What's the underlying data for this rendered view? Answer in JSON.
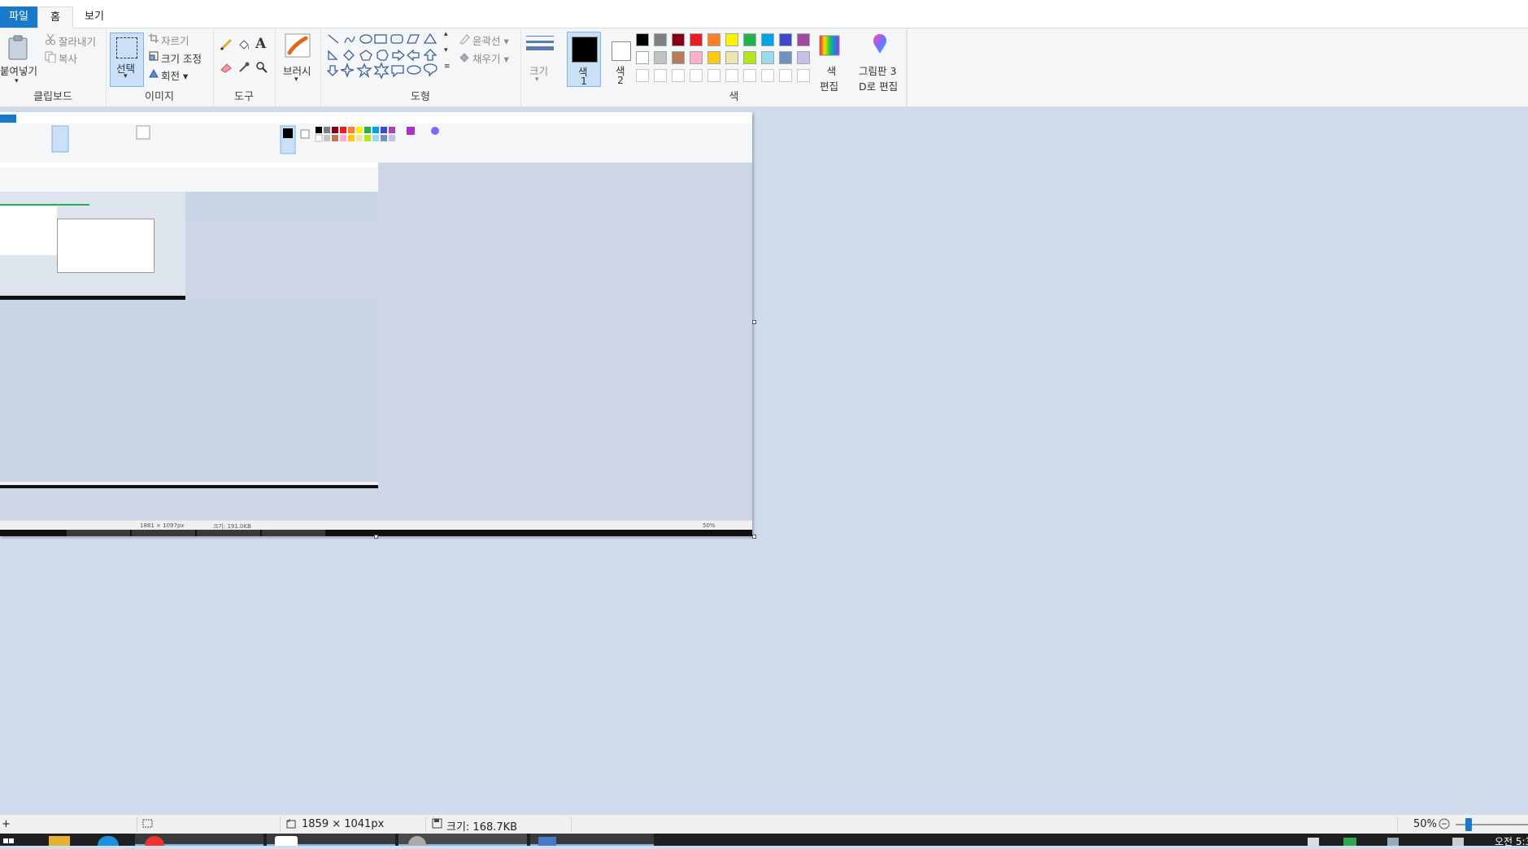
{
  "tabs": {
    "file": "파일",
    "home": "홈",
    "view": "보기"
  },
  "clipboard": {
    "paste": "붙여넣기",
    "cut": "잘라내기",
    "copy": "복사",
    "group": "클립보드"
  },
  "image": {
    "select": "선택",
    "crop": "자르기",
    "resize": "크기 조정",
    "rotate": "회전",
    "group": "이미지"
  },
  "tools": {
    "group": "도구",
    "text_glyph": "A"
  },
  "brush": {
    "label": "브러시"
  },
  "shapes": {
    "outline": "윤곽선",
    "fill": "채우기",
    "group": "도형"
  },
  "size": {
    "label": "크기"
  },
  "colors": {
    "color1_label": "색",
    "color1_num": "1",
    "color2_label": "색",
    "color2_num": "2",
    "edit_label": "색",
    "edit_label2": "편집",
    "group": "색",
    "palette_row1": [
      "#000000",
      "#7f7f7f",
      "#880015",
      "#ed1c24",
      "#ff7f27",
      "#fff200",
      "#22b14c",
      "#00a2e8",
      "#3f48cc",
      "#a349a4"
    ],
    "palette_row2": [
      "#ffffff",
      "#c3c3c3",
      "#b97a57",
      "#ffaec9",
      "#ffc90e",
      "#efe4b0",
      "#b5e61d",
      "#99d9ea",
      "#7092be",
      "#c8bfe7"
    ],
    "palette_row3": [
      "#ffffff",
      "#ffffff",
      "#ffffff",
      "#ffffff",
      "#ffffff",
      "#ffffff",
      "#ffffff",
      "#ffffff",
      "#ffffff",
      "#ffffff"
    ]
  },
  "paint3d": {
    "line1": "그림판 3",
    "line2": "D로 편집"
  },
  "nested": {
    "status_dims": "1881 × 1097px",
    "status_size": "크기: 191.0KB",
    "zoom": "50%"
  },
  "status": {
    "dimensions": "1859 × 1041px",
    "size": "크기: 168.7KB",
    "zoom": "50%",
    "zoom_value": 50
  },
  "taskbar": {
    "clock": "오전 5:3"
  }
}
